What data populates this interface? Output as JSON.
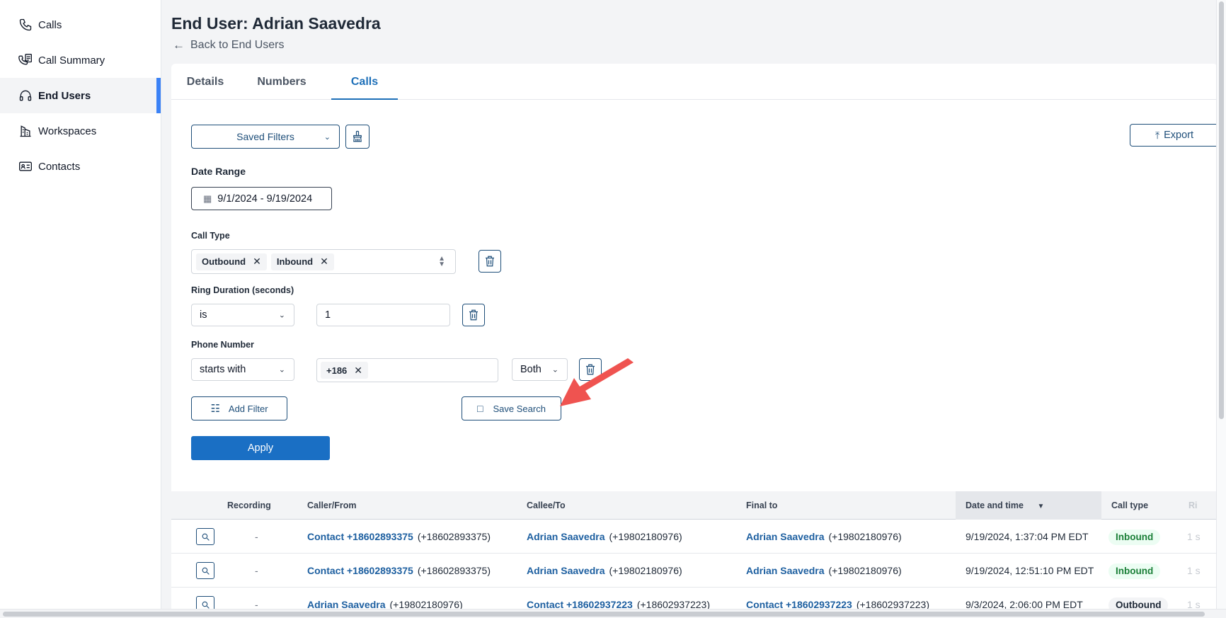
{
  "sidebar": {
    "items": [
      {
        "label": "Calls",
        "icon": "phone-icon"
      },
      {
        "label": "Call Summary",
        "icon": "call-summary-icon"
      },
      {
        "label": "End Users",
        "icon": "headset-icon",
        "active": true
      },
      {
        "label": "Workspaces",
        "icon": "building-icon"
      },
      {
        "label": "Contacts",
        "icon": "contact-card-icon"
      }
    ]
  },
  "header": {
    "title": "End User: Adrian Saavedra",
    "back_label": "Back to End Users"
  },
  "tabs": [
    {
      "label": "Details"
    },
    {
      "label": "Numbers"
    },
    {
      "label": "Calls",
      "active": true
    }
  ],
  "toolbar": {
    "saved_filters_label": "Saved Filters",
    "export_label": "Export"
  },
  "filters": {
    "date_range": {
      "label": "Date Range",
      "value": "9/1/2024 - 9/19/2024"
    },
    "call_type": {
      "label": "Call Type",
      "chips": [
        "Outbound",
        "Inbound"
      ]
    },
    "ring_duration": {
      "label": "Ring Duration (seconds)",
      "operator": "is",
      "value": "1"
    },
    "phone_number": {
      "label": "Phone Number",
      "operator": "starts with",
      "chip": "+186",
      "direction": "Both"
    },
    "add_filter_label": "Add Filter",
    "save_search_label": "Save Search",
    "apply_label": "Apply"
  },
  "table": {
    "columns": [
      "Recording",
      "Caller/From",
      "Callee/To",
      "Final to",
      "Date and time",
      "Call type",
      "Ri"
    ],
    "sort_indicator": "▼",
    "rows": [
      {
        "recording": "-",
        "caller_name": "Contact +18602893375",
        "caller_num": "(+18602893375)",
        "callee_name": "Adrian Saavedra",
        "callee_num": "(+19802180976)",
        "final_name": "Adrian Saavedra",
        "final_num": "(+19802180976)",
        "datetime": "9/19/2024, 1:37:04 PM EDT",
        "call_type": "Inbound",
        "ring": "1 s"
      },
      {
        "recording": "-",
        "caller_name": "Contact +18602893375",
        "caller_num": "(+18602893375)",
        "callee_name": "Adrian Saavedra",
        "callee_num": "(+19802180976)",
        "final_name": "Adrian Saavedra",
        "final_num": "(+19802180976)",
        "datetime": "9/19/2024, 12:51:10 PM EDT",
        "call_type": "Inbound",
        "ring": "1 s"
      },
      {
        "recording": "-",
        "caller_name": "Adrian Saavedra",
        "caller_num": "(+19802180976)",
        "callee_name": "Contact +18602937223",
        "callee_num": "(+18602937223)",
        "final_name": "Contact +18602937223",
        "final_num": "(+18602937223)",
        "datetime": "9/3/2024, 2:06:00 PM EDT",
        "call_type": "Outbound",
        "ring": "1 s"
      }
    ]
  },
  "colors": {
    "accent": "#1a6fc4",
    "active_indicator": "#3b82f6",
    "annotation_arrow": "#ef5350"
  }
}
